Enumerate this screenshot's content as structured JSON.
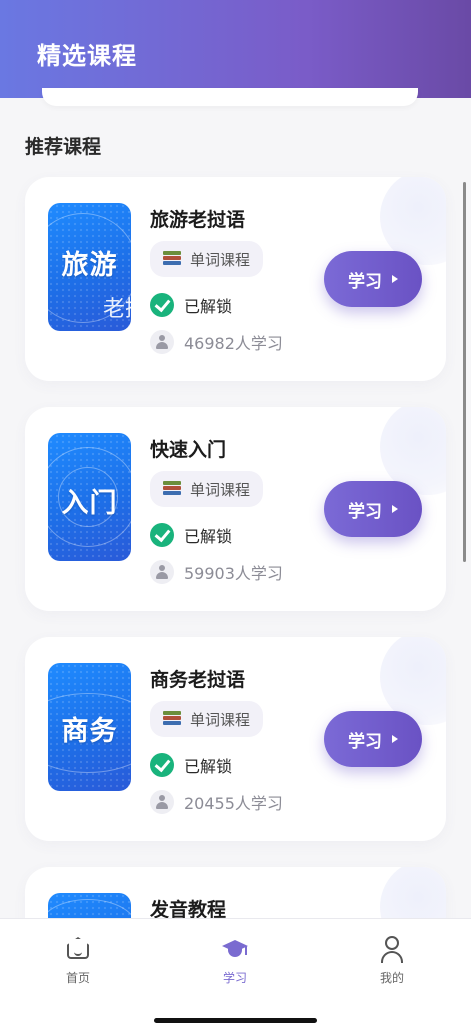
{
  "header": {
    "title": "精选课程"
  },
  "section": {
    "title": "推荐课程"
  },
  "courses": [
    {
      "title": "旅游老挝语",
      "thumb_big": "旅游",
      "thumb_small": "老挝",
      "tag": "单词课程",
      "status": "已解锁",
      "learners": "46982人学习",
      "button": "学习"
    },
    {
      "title": "快速入门",
      "thumb_big": "入门",
      "thumb_small": "",
      "tag": "单词课程",
      "status": "已解锁",
      "learners": "59903人学习",
      "button": "学习"
    },
    {
      "title": "商务老挝语",
      "thumb_big": "商务",
      "thumb_small": "",
      "tag": "单词课程",
      "status": "已解锁",
      "learners": "20455人学习",
      "button": "学习"
    },
    {
      "title": "发音教程",
      "thumb_big": "",
      "thumb_small": "",
      "tag": "",
      "status": "",
      "learners": "",
      "button": ""
    }
  ],
  "tabbar": {
    "items": [
      {
        "label": "首页",
        "icon": "home-icon",
        "active": false
      },
      {
        "label": "学习",
        "icon": "graduation-cap-icon",
        "active": true
      },
      {
        "label": "我的",
        "icon": "user-icon",
        "active": false
      }
    ]
  },
  "colors": {
    "accent": "#7a6bd0",
    "header_start": "#6a78e2",
    "header_end": "#6a4aa6",
    "check": "#19b37c"
  },
  "icons": {
    "tag": "books-icon",
    "status": "check-circle-icon",
    "learners": "person-icon",
    "button": "play-triangle-icon"
  }
}
